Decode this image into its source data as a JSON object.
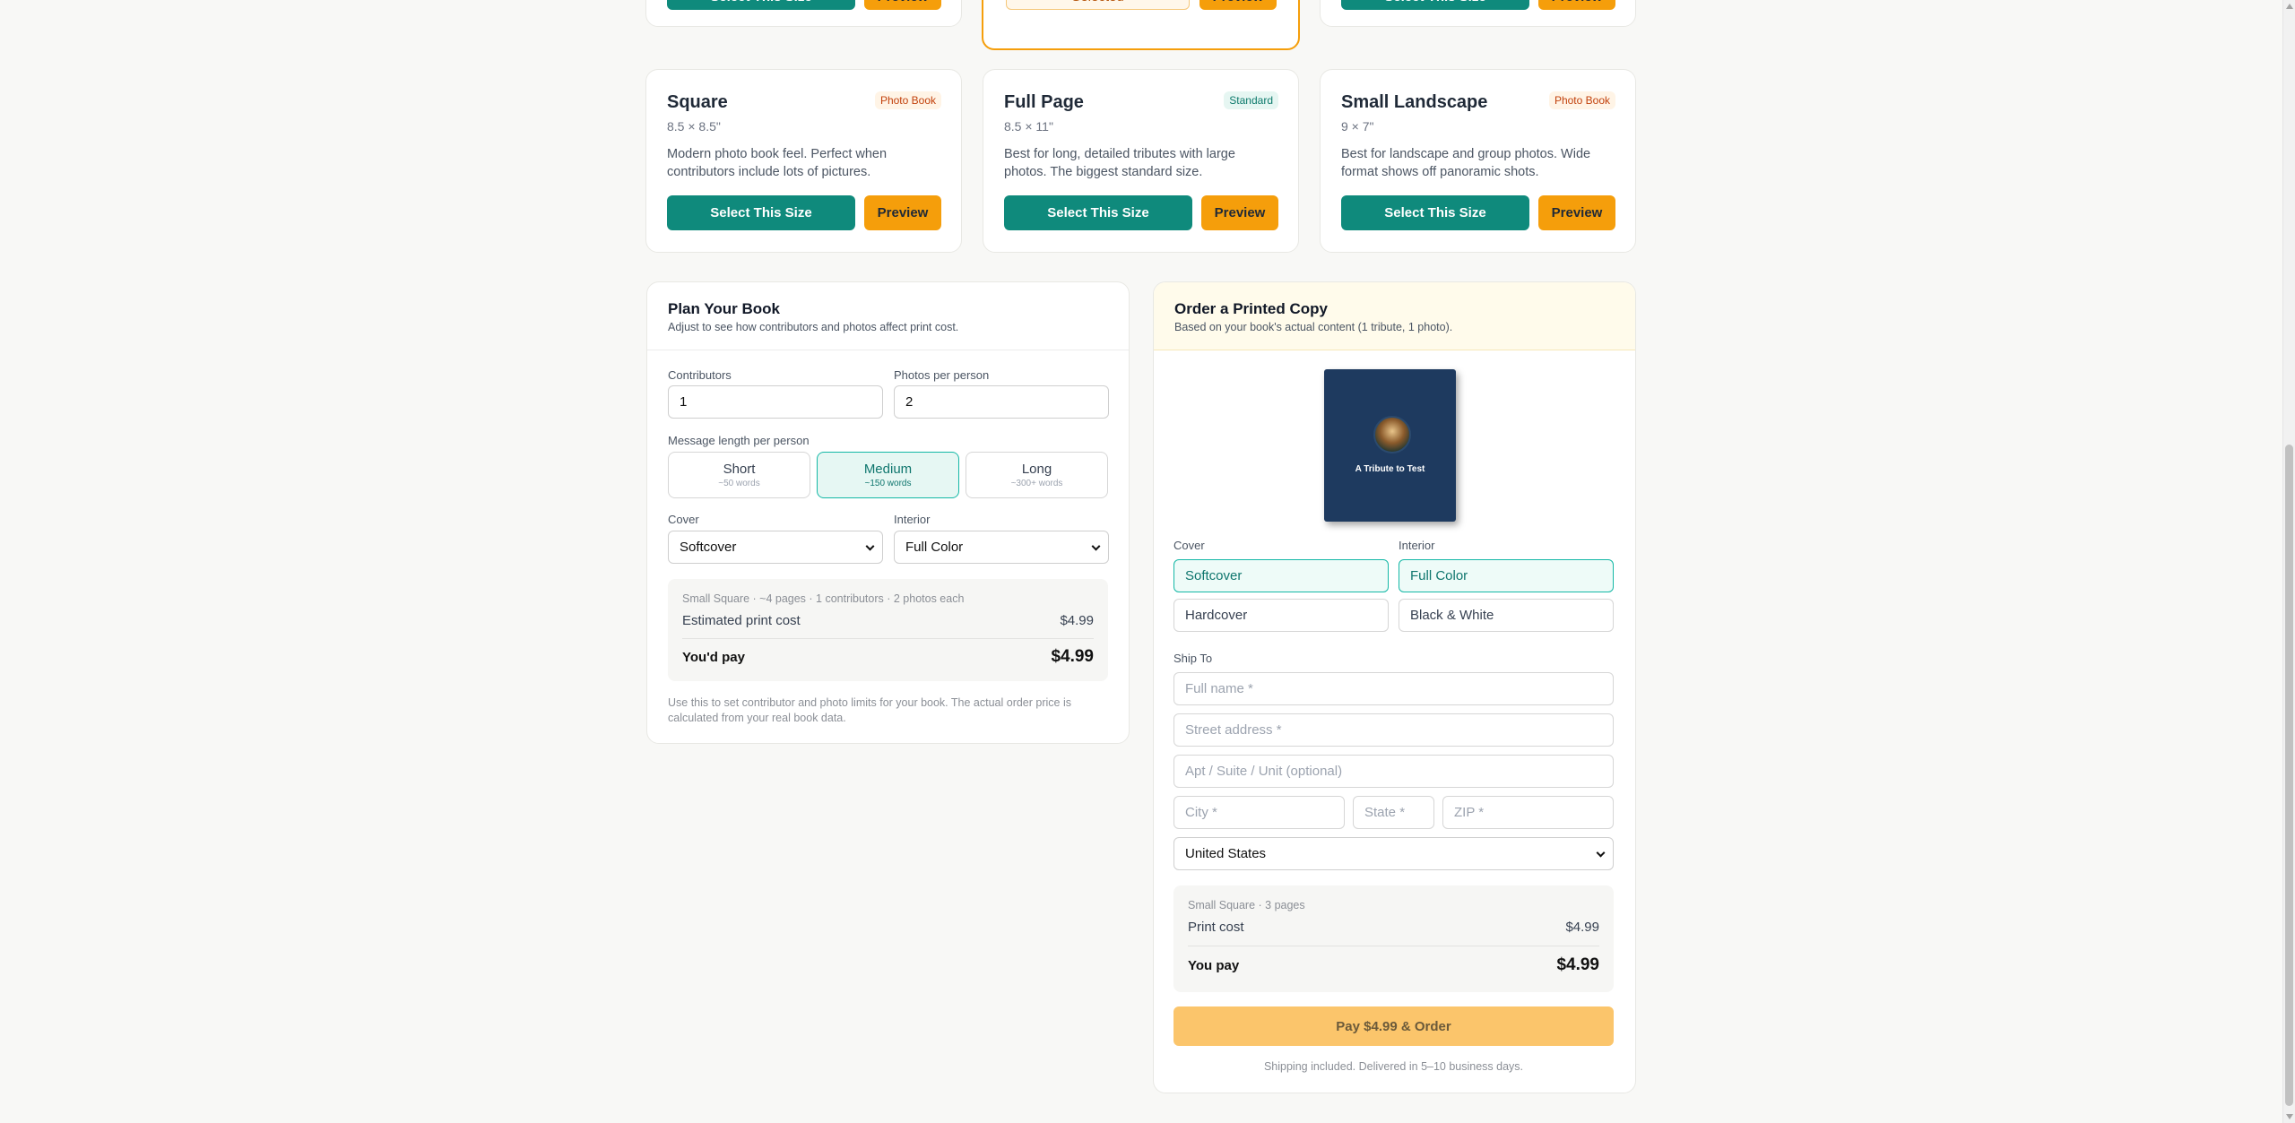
{
  "top_cards": [
    {
      "select_label": "Select This Size",
      "preview_label": "Preview"
    },
    {
      "selected_label": "Selected",
      "preview_label": "Preview"
    },
    {
      "select_label": "Select This Size",
      "preview_label": "Preview"
    }
  ],
  "size_cards": [
    {
      "title": "Square",
      "dims": "8.5 × 8.5\"",
      "badge": "Photo Book",
      "desc": "Modern photo book feel. Perfect when contributors include lots of pictures.",
      "select_label": "Select This Size",
      "preview_label": "Preview"
    },
    {
      "title": "Full Page",
      "dims": "8.5 × 11\"",
      "badge": "Standard",
      "desc": "Best for long, detailed tributes with large photos. The biggest standard size.",
      "select_label": "Select This Size",
      "preview_label": "Preview"
    },
    {
      "title": "Small Landscape",
      "dims": "9 × 7\"",
      "badge": "Photo Book",
      "desc": "Best for landscape and group photos. Wide format shows off panoramic shots.",
      "select_label": "Select This Size",
      "preview_label": "Preview"
    }
  ],
  "plan": {
    "title": "Plan Your Book",
    "subtitle": "Adjust to see how contributors and photos affect print cost.",
    "contributors_label": "Contributors",
    "contributors_value": "1",
    "photos_label": "Photos per person",
    "photos_value": "2",
    "message_label": "Message length per person",
    "lengths": [
      {
        "label": "Short",
        "sub": "~50 words"
      },
      {
        "label": "Medium",
        "sub": "~150 words"
      },
      {
        "label": "Long",
        "sub": "~300+ words"
      }
    ],
    "active_length": "Medium",
    "cover_label": "Cover",
    "cover_value": "Softcover",
    "interior_label": "Interior",
    "interior_value": "Full Color",
    "summary_meta": "Small Square · ~4 pages · 1 contributors · 2 photos each",
    "estimated_label": "Estimated print cost",
    "estimated_value": "$4.99",
    "pay_label": "You'd pay",
    "pay_value": "$4.99",
    "note": "Use this to set contributor and photo limits for your book. The actual order price is calculated from your real book data."
  },
  "order": {
    "title": "Order a Printed Copy",
    "subtitle": "Based on your book's actual content (1 tribute, 1 photo).",
    "book_title": "A Tribute to Test",
    "cover_label": "Cover",
    "cover_options": [
      "Softcover",
      "Hardcover"
    ],
    "cover_selected": "Softcover",
    "interior_label": "Interior",
    "interior_options": [
      "Full Color",
      "Black & White"
    ],
    "interior_selected": "Full Color",
    "ship_to_label": "Ship To",
    "full_name_ph": "Full name *",
    "street_ph": "Street address *",
    "apt_ph": "Apt / Suite / Unit (optional)",
    "city_ph": "City *",
    "state_ph": "State *",
    "zip_ph": "ZIP *",
    "country": "United States",
    "summary_meta": "Small Square · 3 pages",
    "print_cost_label": "Print cost",
    "print_cost_value": "$4.99",
    "you_pay_label": "You pay",
    "you_pay_value": "$4.99",
    "pay_button": "Pay $4.99 & Order",
    "shipping_note": "Shipping included. Delivered in 5–10 business days."
  },
  "colors": {
    "teal": "#0f8a7c",
    "amber": "#f59e0b",
    "pay_disabled": "#fbc56b"
  }
}
